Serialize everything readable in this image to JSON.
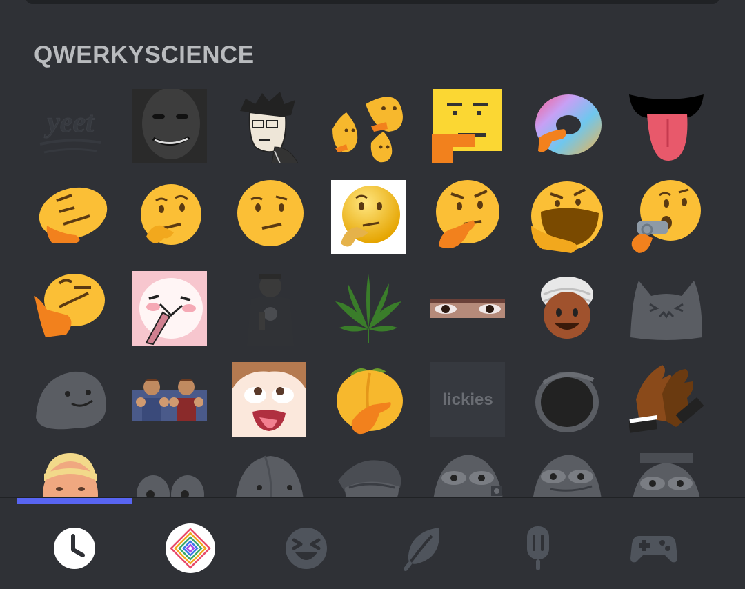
{
  "search": {
    "placeholder": ""
  },
  "section": {
    "title": "QWERKYSCIENCE"
  },
  "emojis": [
    {
      "name": "yeet-emoji",
      "label": "yeet"
    },
    {
      "name": "dark-face-smile-emoji"
    },
    {
      "name": "glasses-man-drawing-emoji"
    },
    {
      "name": "triple-thinking-emoji"
    },
    {
      "name": "square-thinking-emoji"
    },
    {
      "name": "torus-thinking-emoji"
    },
    {
      "name": "tongue-out-emoji"
    },
    {
      "name": "tilted-thinking-emoji"
    },
    {
      "name": "thinking-emoji"
    },
    {
      "name": "unamused-face-emoji"
    },
    {
      "name": "3d-thinking-emoji"
    },
    {
      "name": "thinking-pointing-emoji"
    },
    {
      "name": "big-mouth-thinking-emoji"
    },
    {
      "name": "gun-thinking-emoji"
    },
    {
      "name": "sideways-thinking-emoji"
    },
    {
      "name": "pink-bear-emoji"
    },
    {
      "name": "singer-photo-emoji"
    },
    {
      "name": "cannabis-leaf-emoji"
    },
    {
      "name": "staring-eyes-emoji"
    },
    {
      "name": "turban-face-emoji"
    },
    {
      "name": "gray-cat-emoji"
    },
    {
      "name": "blob-smile-emoji"
    },
    {
      "name": "two-men-ok-hands-emoji"
    },
    {
      "name": "anime-face-emoji"
    },
    {
      "name": "peach-pointing-emoji"
    },
    {
      "name": "lickies-emoji",
      "label": "lickies"
    },
    {
      "name": "dark-ring-emoji"
    },
    {
      "name": "clapping-hands-emoji"
    },
    {
      "name": "trump-face-emoji"
    },
    {
      "name": "googly-eyes-emoji"
    },
    {
      "name": "gray-blob-emoji"
    },
    {
      "name": "pepe-hat-emoji"
    },
    {
      "name": "pepe-camera-emoji"
    },
    {
      "name": "pepe-smirk-emoji"
    },
    {
      "name": "pepe-police-emoji"
    }
  ],
  "tabs": [
    {
      "name": "tab-recent",
      "icon": "clock-icon",
      "active": true
    },
    {
      "name": "tab-custom-server",
      "icon": "server-logo-icon"
    },
    {
      "name": "tab-people",
      "icon": "smiley-icon"
    },
    {
      "name": "tab-nature",
      "icon": "leaf-icon"
    },
    {
      "name": "tab-food",
      "icon": "popsicle-icon"
    },
    {
      "name": "tab-activities",
      "icon": "gamepad-icon"
    }
  ],
  "colors": {
    "background": "#2f3136",
    "accent": "#5865f2",
    "header_text": "#b9bbbe",
    "icon": "#4f545c"
  }
}
